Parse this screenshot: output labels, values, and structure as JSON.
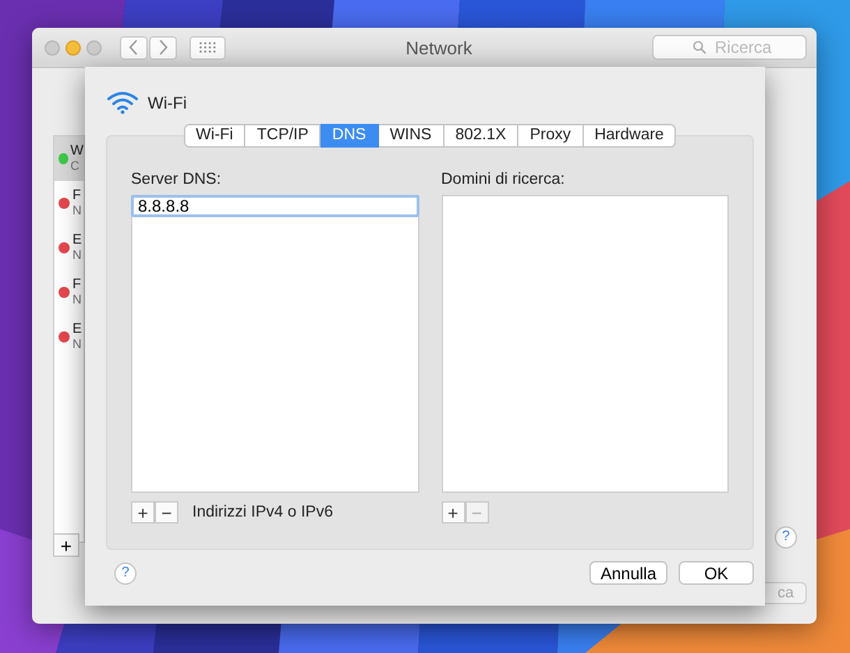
{
  "window": {
    "title": "Network",
    "search": {
      "placeholder": "Ricerca"
    }
  },
  "sidebar": {
    "items": [
      {
        "name": "W",
        "status": "C",
        "color": "#3ec94a",
        "selected": true
      },
      {
        "name": "F",
        "status": "N",
        "color": "#e5484d",
        "selected": false
      },
      {
        "name": "E",
        "status": "N",
        "color": "#e5484d",
        "selected": false
      },
      {
        "name": "F",
        "status": "N",
        "color": "#e5484d",
        "selected": false
      },
      {
        "name": "E",
        "status": "N",
        "color": "#e5484d",
        "selected": false
      }
    ],
    "add": "+"
  },
  "window_help": "?",
  "window_button": "ca",
  "sheet": {
    "service": "Wi-Fi",
    "tabs": [
      {
        "label": "Wi-Fi",
        "selected": false
      },
      {
        "label": "TCP/IP",
        "selected": false
      },
      {
        "label": "DNS",
        "selected": true
      },
      {
        "label": "WINS",
        "selected": false
      },
      {
        "label": "802.1X",
        "selected": false
      },
      {
        "label": "Proxy",
        "selected": false
      },
      {
        "label": "Hardware",
        "selected": false
      }
    ],
    "dns_servers": {
      "label": "Server DNS:",
      "values": [
        "8.8.8.8"
      ],
      "add": {
        "text": "+",
        "disabled": false
      },
      "remove": {
        "text": "−",
        "disabled": false
      },
      "hint": "Indirizzi IPv4 o IPv6"
    },
    "search_domains": {
      "label": "Domini di ricerca:",
      "add": {
        "text": "+",
        "disabled": false
      },
      "remove": {
        "text": "−",
        "disabled": true
      }
    },
    "help": "?",
    "buttons": [
      "Annulla",
      "OK"
    ]
  }
}
